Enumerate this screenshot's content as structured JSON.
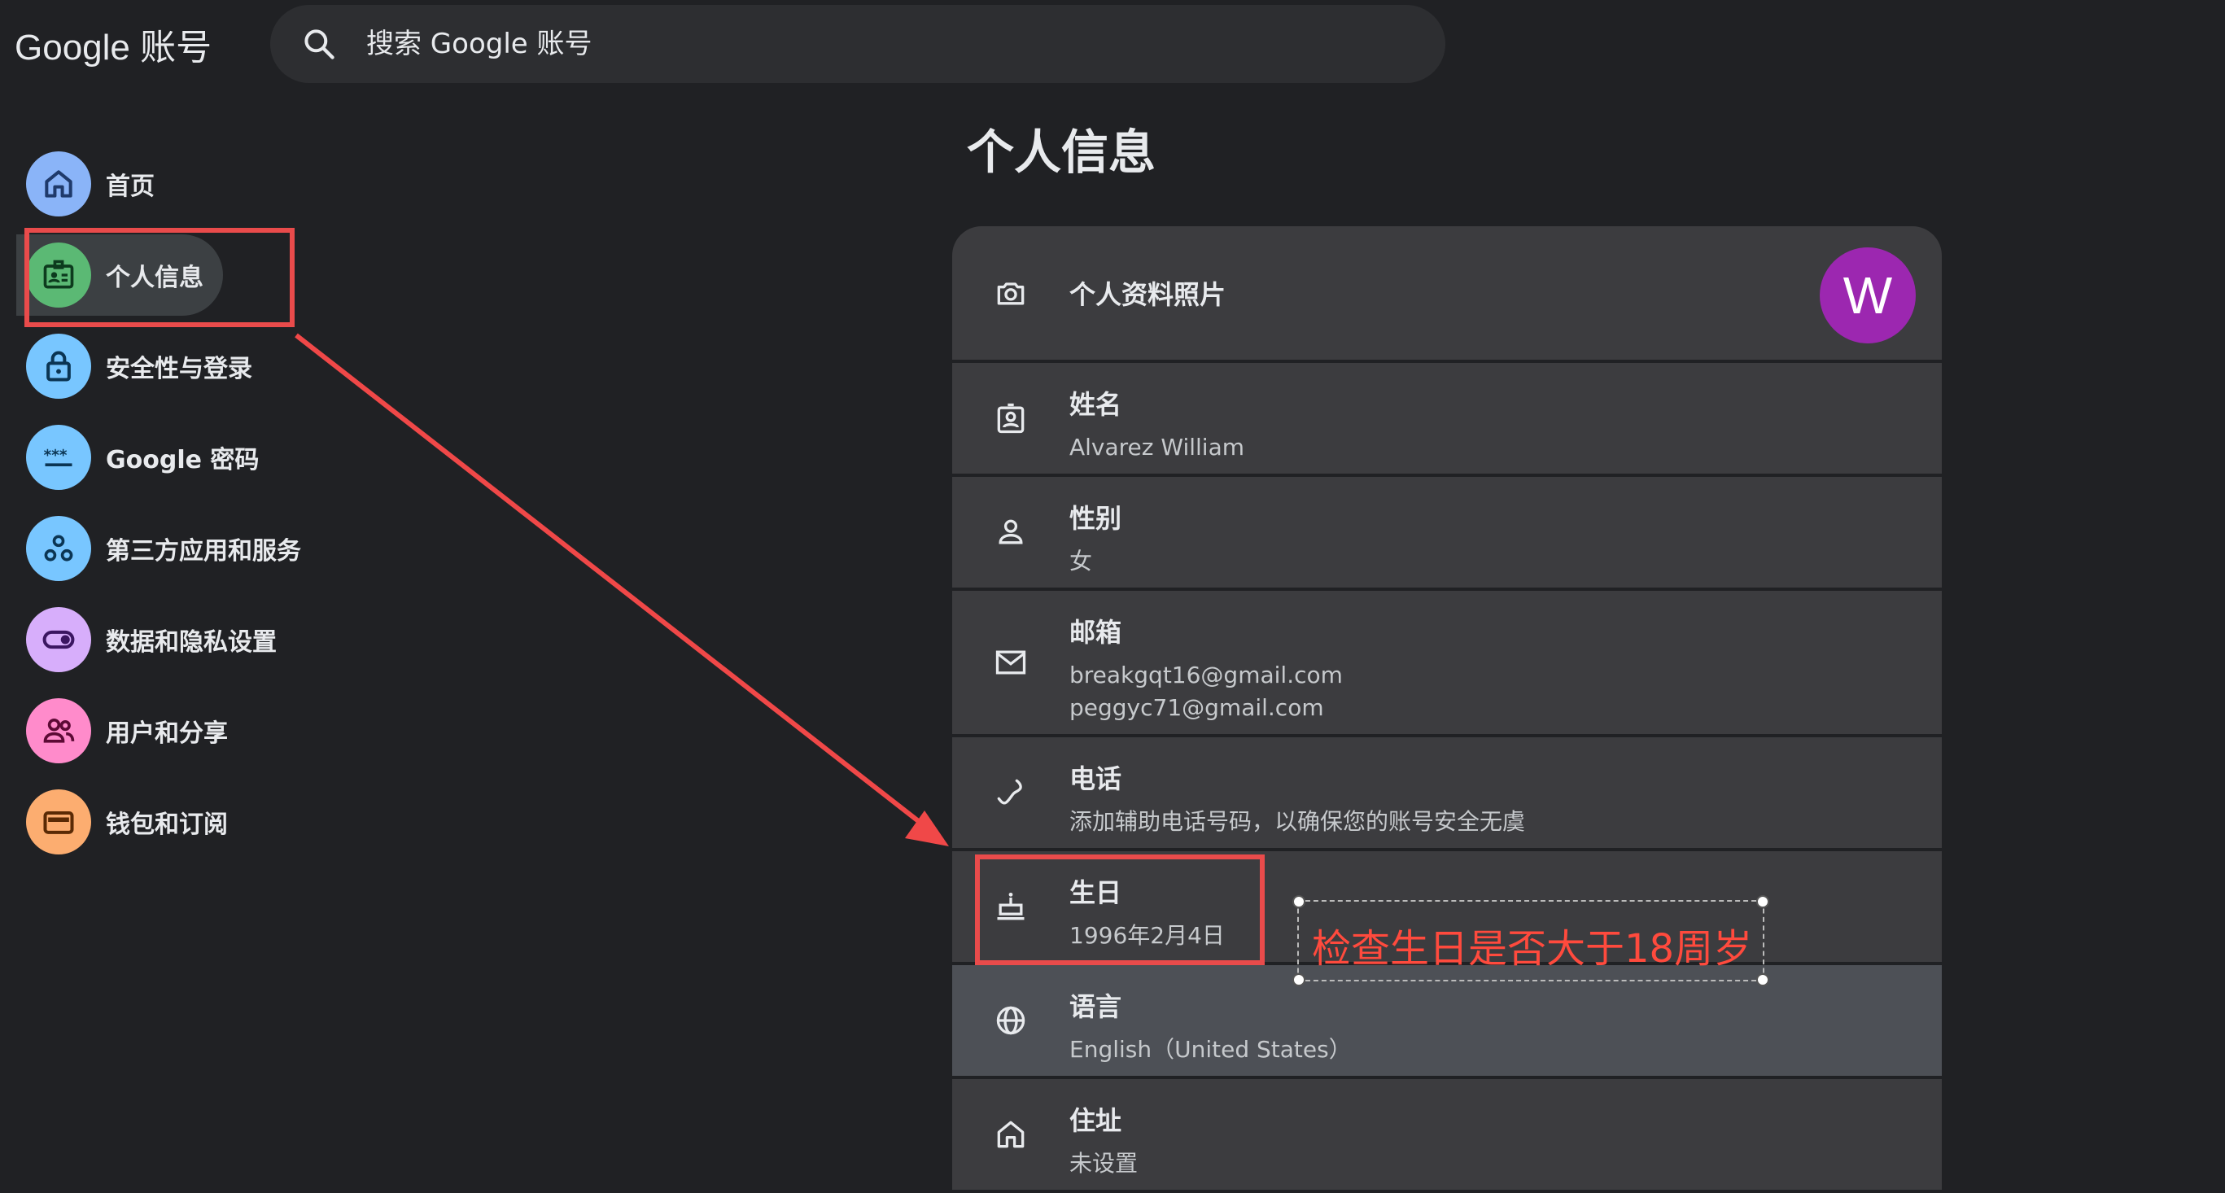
{
  "header": {
    "logo": "Google 账号",
    "search_placeholder": "搜索 Google 账号"
  },
  "sidebar": {
    "items": [
      {
        "label": "首页",
        "icon": "home-icon",
        "color": "#8ab4f8"
      },
      {
        "label": "个人信息",
        "icon": "id-card-icon",
        "color": "#5bb974",
        "active": true
      },
      {
        "label": "安全性与登录",
        "icon": "lock-icon",
        "color": "#78c6ff"
      },
      {
        "label": "Google 密码",
        "icon": "password-dots-icon",
        "color": "#78c6ff"
      },
      {
        "label": "第三方应用和服务",
        "icon": "apps-connected-icon",
        "color": "#78c6ff"
      },
      {
        "label": "数据和隐私设置",
        "icon": "toggle-icon",
        "color": "#d7aefb"
      },
      {
        "label": "用户和分享",
        "icon": "people-icon",
        "color": "#ff8bcb"
      },
      {
        "label": "钱包和订阅",
        "icon": "wallet-icon",
        "color": "#fcad70"
      }
    ]
  },
  "main": {
    "title": "个人信息",
    "rows": [
      {
        "title": "个人资料照片",
        "icon": "camera-icon",
        "avatar": "W"
      },
      {
        "title": "姓名",
        "icon": "badge-icon",
        "value": "Alvarez William"
      },
      {
        "title": "性别",
        "icon": "person-icon",
        "value": "女"
      },
      {
        "title": "邮箱",
        "icon": "mail-icon",
        "value": "breakgqt16@gmail.com",
        "value2": "peggyc71@gmail.com"
      },
      {
        "title": "电话",
        "icon": "phone-icon",
        "value": "添加辅助电话号码，以确保您的账号安全无虞"
      },
      {
        "title": "生日",
        "icon": "cake-icon",
        "value": "1996年2月4日"
      },
      {
        "title": "语言",
        "icon": "globe-icon",
        "value": "English（United States）"
      },
      {
        "title": "住址",
        "icon": "home-outline-icon",
        "value": "未设置"
      }
    ]
  },
  "annotation": {
    "note": "检查生日是否大于18周岁",
    "color": "#ff4a3d"
  },
  "colors": {
    "background": "#202124",
    "card": "#3c3c3f",
    "highlight": "#4d5056",
    "avatar": "#9c27b0"
  }
}
